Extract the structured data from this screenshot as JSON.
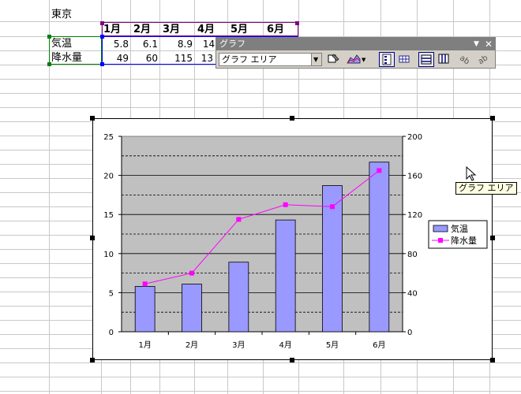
{
  "sheet": {
    "city": "東京",
    "months": [
      "1月",
      "2月",
      "3月",
      "4月",
      "5月",
      "6月"
    ],
    "row_temp": {
      "label": "気温",
      "values": [
        "5.8",
        "6.1",
        "8.9",
        "14.",
        "",
        ""
      ]
    },
    "row_rain": {
      "label": "降水量",
      "values": [
        "49",
        "60",
        "115",
        "13",
        "",
        ""
      ]
    }
  },
  "toolbar": {
    "title": "グラフ",
    "object_select": "グラフ エリア",
    "menu_icon": "dropdown-arrow-icon",
    "close_icon": "close-icon"
  },
  "tooltip": {
    "text": "グラフ エリア"
  },
  "chart_data": {
    "type": "bar",
    "categories": [
      "1月",
      "2月",
      "3月",
      "4月",
      "5月",
      "6月"
    ],
    "series": [
      {
        "name": "気温",
        "type": "bar",
        "axis": "left",
        "values": [
          5.8,
          6.1,
          8.9,
          14.3,
          18.7,
          21.7
        ],
        "color": "#9999ff"
      },
      {
        "name": "降水量",
        "type": "line",
        "axis": "right",
        "values": [
          49,
          60,
          115,
          130,
          128,
          165
        ],
        "color": "#ff00ff"
      }
    ],
    "y_left": {
      "min": 0,
      "max": 25,
      "ticks": [
        0,
        5,
        10,
        15,
        20,
        25
      ]
    },
    "y_right": {
      "min": 0,
      "max": 200,
      "ticks": [
        0,
        40,
        80,
        120,
        160,
        200
      ]
    },
    "plot_bg": "#c0c0c0",
    "grid": true,
    "legend_position": "right"
  }
}
